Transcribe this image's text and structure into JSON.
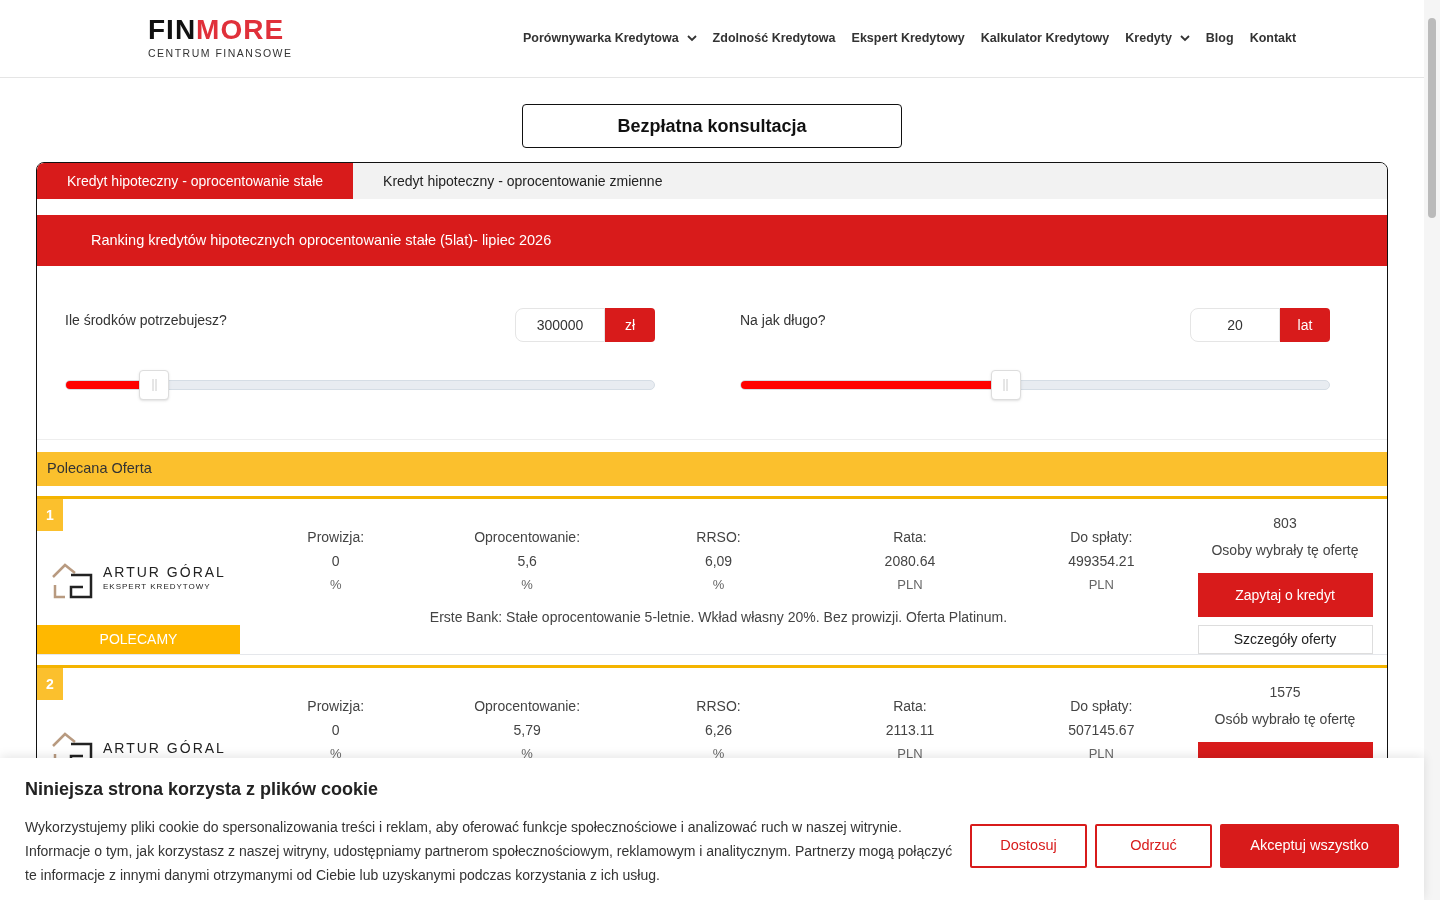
{
  "header": {
    "logo": {
      "dark": "FIN",
      "accent": "MORE",
      "tagline": "CENTRUM FINANSOWE"
    },
    "nav": [
      {
        "label": "Porównywarka Kredytowa",
        "dropdown": true
      },
      {
        "label": "Zdolność Kredytowa",
        "dropdown": false
      },
      {
        "label": "Ekspert Kredytowy",
        "dropdown": false
      },
      {
        "label": "Kalkulator Kredytowy",
        "dropdown": false
      },
      {
        "label": "Kredyty",
        "dropdown": true
      },
      {
        "label": "Blog",
        "dropdown": false
      },
      {
        "label": "Kontakt",
        "dropdown": false
      }
    ]
  },
  "consult_button": "Bezpłatna konsultacja",
  "tabs": [
    {
      "label": "Kredyt hipoteczny - oprocentowanie stałe",
      "selected": true
    },
    {
      "label": "Kredyt hipoteczny - oprocentowanie zmienne",
      "selected": false
    }
  ],
  "ranking_title": "Ranking kredytów hipotecznych oprocentowanie stałe (5lat)- lipiec 2026",
  "calculators": [
    {
      "question": "Ile środków potrzebujesz?",
      "value": "300000",
      "unit": "zł",
      "level": 0.15
    },
    {
      "question": "Na jak długo?",
      "value": "20",
      "unit": "lat",
      "level": 0.45
    }
  ],
  "featured_label": "Polecana Oferta",
  "offers": [
    {
      "rank": "1",
      "brand": "ARTUR GÓRAL",
      "brand_sub": "EKSPERT KREDYTOWY",
      "stats": [
        {
          "label": "Prowizja:",
          "value": "0",
          "unit": "%"
        },
        {
          "label": "Oprocentowanie:",
          "value": "5,6",
          "unit": "%"
        },
        {
          "label": "RRSO:",
          "value": "6,09",
          "unit": "%"
        },
        {
          "label": "Rata:",
          "value": "2080.64",
          "unit": "PLN"
        },
        {
          "label": "Do spłaty:",
          "value": "499354.21",
          "unit": "PLN"
        }
      ],
      "count": "803",
      "count_label": "Osoby wybrały tę ofertę",
      "ask": "Zapytaj o kredyt",
      "details": "Szczegóły oferty",
      "description": "Erste Bank: Stałe oprocentowanie 5-letnie. Wkład własny 20%. Bez prowizji. Oferta Platinum.",
      "badge": "POLECAMY"
    },
    {
      "rank": "2",
      "brand": "ARTUR GÓRAL",
      "stats": [
        {
          "label": "Prowizja:",
          "value": "0",
          "unit": "%"
        },
        {
          "label": "Oprocentowanie:",
          "value": "5,79",
          "unit": "%"
        },
        {
          "label": "RRSO:",
          "value": "6,26",
          "unit": "%"
        },
        {
          "label": "Rata:",
          "value": "2113.11",
          "unit": "PLN"
        },
        {
          "label": "Do spłaty:",
          "value": "507145.67",
          "unit": "PLN"
        }
      ],
      "count": "1575",
      "count_label": "Osób wybrało tę ofertę"
    }
  ],
  "cookie": {
    "title": "Niniejsza strona korzysta z plików cookie",
    "text": "Wykorzystujemy pliki cookie do spersonalizowania treści i reklam, aby oferować funkcje społecznościowe i analizować ruch w naszej witrynie. Informacje o tym, jak korzystasz z naszej witryny, udostępniamy partnerom społecznościowym, reklamowym i analitycznym. Partnerzy mogą połączyć te informacje z innymi danymi otrzymanymi od Ciebie lub uzyskanymi podczas korzystania z ich usług.",
    "buttons": [
      {
        "label": "Dostosuj",
        "kind": "outline"
      },
      {
        "label": "Odrzuć",
        "kind": "outline"
      },
      {
        "label": "Akceptuj wszystko",
        "kind": "solid"
      }
    ]
  }
}
